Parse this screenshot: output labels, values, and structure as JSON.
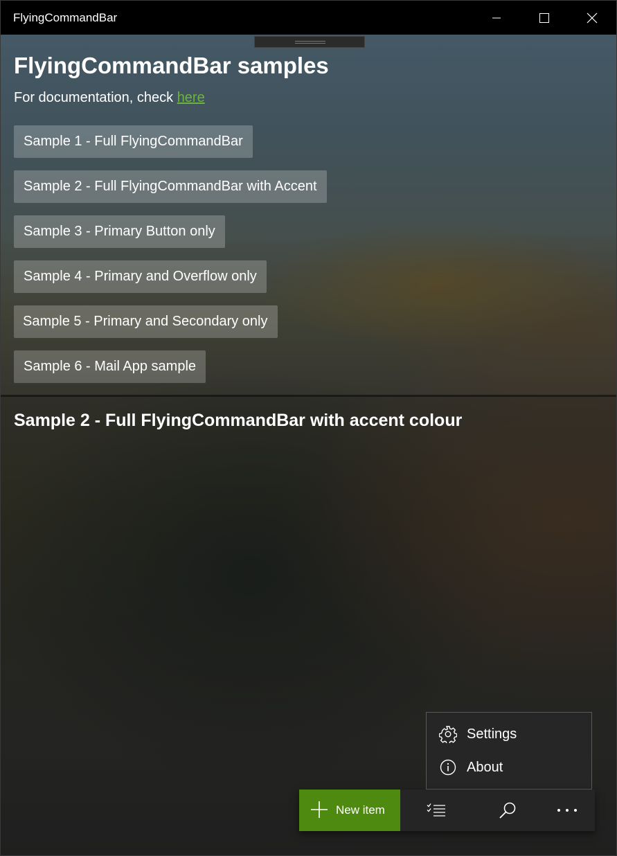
{
  "window": {
    "title": "FlyingCommandBar",
    "controls": {
      "minimize": "minimize-icon",
      "maximize": "maximize-icon",
      "close": "close-icon"
    }
  },
  "main": {
    "heading": "FlyingCommandBar samples",
    "doc_prefix": "For documentation, check",
    "doc_link": "here",
    "link_color": "#6db33f",
    "samples": [
      {
        "label": "Sample 1 - Full FlyingCommandBar"
      },
      {
        "label": "Sample 2 - Full FlyingCommandBar with Accent"
      },
      {
        "label": "Sample 3 - Primary Button only"
      },
      {
        "label": "Sample 4 - Primary and Overflow only"
      },
      {
        "label": "Sample 5 - Primary and Secondary only"
      },
      {
        "label": "Sample 6 - Mail App sample"
      }
    ]
  },
  "detail": {
    "section_title": "Sample 2 - Full FlyingCommandBar with accent colour"
  },
  "overflow_menu": {
    "items": [
      {
        "label": "Settings",
        "icon": "gear-icon"
      },
      {
        "label": "About",
        "icon": "info-icon"
      }
    ]
  },
  "command_bar": {
    "accent_color": "#4f8a10",
    "primary": {
      "label": "New item",
      "icon": "plus-icon"
    },
    "secondary": [
      {
        "icon": "checklist-icon"
      },
      {
        "icon": "search-icon"
      }
    ],
    "more": {
      "icon": "more-icon"
    }
  }
}
